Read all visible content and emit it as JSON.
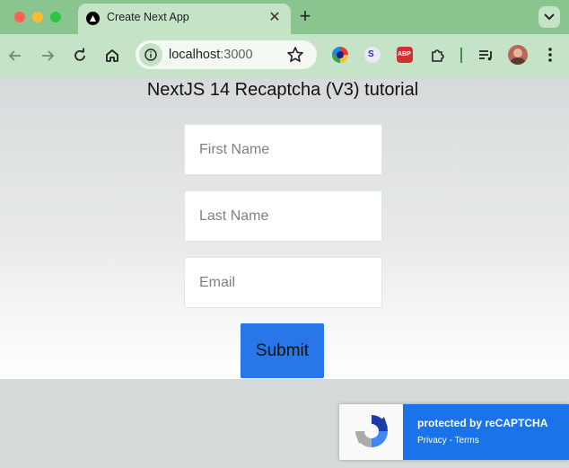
{
  "browser": {
    "tab": {
      "title": "Create Next App",
      "close": "✕"
    },
    "new_tab": "+",
    "url": {
      "host": "localhost",
      "port": ":3000"
    },
    "extensions": [
      "color-picker-extension-icon",
      "translate-extension-icon",
      "adblock-plus-icon",
      "puzzle-extensions-icon",
      "reading-list-icon"
    ]
  },
  "page": {
    "title": "NextJS 14 Recaptcha (V3) tutorial",
    "fields": {
      "first_name": {
        "placeholder": "First Name",
        "value": ""
      },
      "last_name": {
        "placeholder": "Last Name",
        "value": ""
      },
      "email": {
        "placeholder": "Email",
        "value": ""
      }
    },
    "submit_label": "Submit"
  },
  "recaptcha": {
    "protected_by": "protected by reCAPTCHA",
    "privacy": "Privacy",
    "separator": " - ",
    "terms": "Terms"
  },
  "colors": {
    "tab_strip": "#8ac48e",
    "toolbar": "#c5e3c6",
    "submit_button": "#2877e9",
    "recaptcha_blue": "#1a73e8"
  }
}
